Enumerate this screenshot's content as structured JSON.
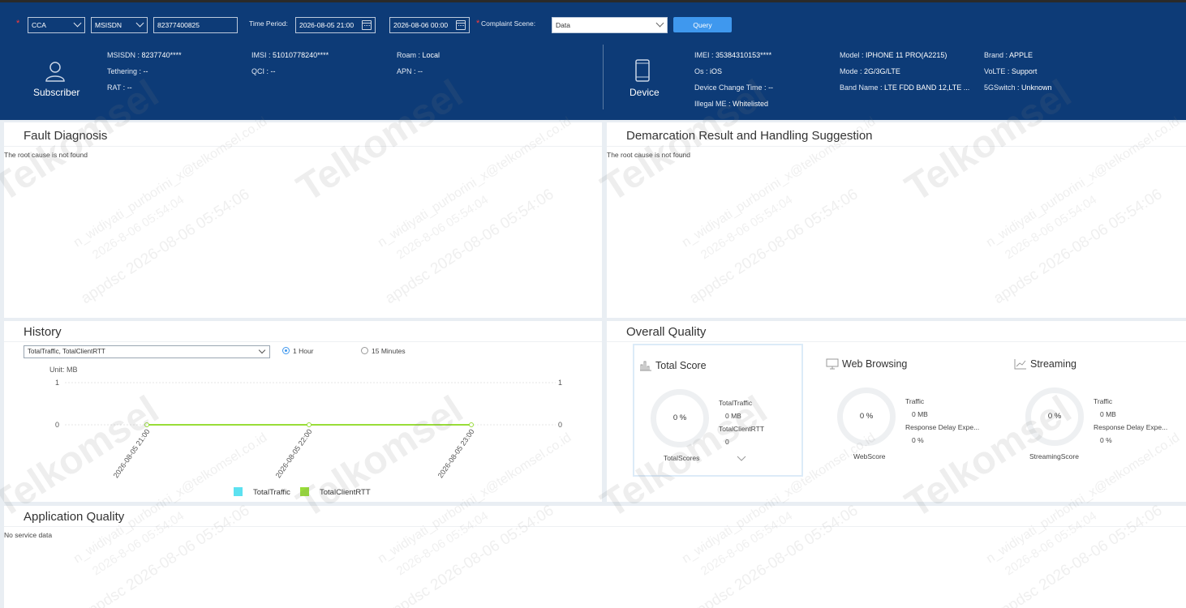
{
  "filters": {
    "mode_select": "CCA",
    "type_select": "MSISDN",
    "msisdn_value": "82377400825",
    "time_period_label": "Time Period:",
    "start_time": "2026-08-05 21:00",
    "end_time": "2026-08-06 00:00",
    "complaint_scene_label": "Complaint Scene:",
    "complaint_scene_value": "Data",
    "query_label": "Query"
  },
  "subscriber": {
    "label": "Subscriber",
    "fields": [
      {
        "k": "MSISDN",
        "v": "8237740****"
      },
      {
        "k": "Tethering",
        "v": "--"
      },
      {
        "k": "RAT",
        "v": "--"
      },
      {
        "k": "IMSI",
        "v": "51010778240****"
      },
      {
        "k": "QCI",
        "v": "--"
      },
      {
        "k": "Roam",
        "v": "Local"
      },
      {
        "k": "APN",
        "v": "--"
      }
    ]
  },
  "device": {
    "label": "Device",
    "fields": [
      {
        "k": "IMEI",
        "v": "35384310153****"
      },
      {
        "k": "Os",
        "v": "iOS"
      },
      {
        "k": "Device Change Time",
        "v": "--"
      },
      {
        "k": "Illegal ME",
        "v": "Whitelisted"
      },
      {
        "k": "Model",
        "v": "IPHONE 11 PRO(A2215)"
      },
      {
        "k": "Mode",
        "v": "2G/3G/LTE"
      },
      {
        "k": "Band Name",
        "v": "LTE FDD BAND 12,LTE ..."
      },
      {
        "k": "Brand",
        "v": "APPLE"
      },
      {
        "k": "VoLTE",
        "v": "Support"
      },
      {
        "k": "5GSwitch",
        "v": "Unknown"
      }
    ]
  },
  "fault_diagnosis": {
    "title": "Fault Diagnosis",
    "message": "The root cause is not found"
  },
  "demarcation": {
    "title": "Demarcation Result and Handling Suggestion",
    "message": "The root cause is not found"
  },
  "history": {
    "title": "History",
    "metric_select": "TotalTraffic, TotalClientRTT",
    "radio_1h": "1 Hour",
    "radio_15m": "15 Minutes",
    "selected_interval": "1 Hour"
  },
  "chart_data": {
    "type": "line",
    "unit_label": "Unit: MB",
    "x": [
      "2026-08-05 21:00",
      "2026-08-05 22:00",
      "2026-08-05 23:00"
    ],
    "series": [
      {
        "name": "TotalTraffic",
        "values": [
          0,
          0,
          0
        ],
        "color": "#5ce1f0"
      },
      {
        "name": "TotalClientRTT",
        "values": [
          0,
          0,
          0
        ],
        "color": "#98dd38"
      }
    ],
    "y_left_ticks": [
      "1",
      "0"
    ],
    "y_right_ticks": [
      "1",
      "0"
    ],
    "ylim": [
      0,
      1
    ],
    "grid": true,
    "legend_placement": "bottom"
  },
  "overall_quality": {
    "title": "Overall Quality",
    "cards": [
      {
        "title": "Total Score",
        "icon": "bar-chart-icon",
        "score": "0 %",
        "k1": "TotalTraffic",
        "v1": "0 MB",
        "k2": "TotalClientRTT",
        "v2": "0",
        "footer": "TotalScores"
      },
      {
        "title": "Web Browsing",
        "icon": "monitor-icon",
        "score": "0 %",
        "k1": "Traffic",
        "v1": "0 MB",
        "k2": "Response Delay Expe...",
        "v2": "0 %",
        "footer": "WebScore"
      },
      {
        "title": "Streaming",
        "icon": "line-chart-icon",
        "score": "0 %",
        "k1": "Traffic",
        "v1": "0 MB",
        "k2": "Response Delay Expe...",
        "v2": "0 %",
        "footer": "StreamingScore"
      }
    ]
  },
  "application_quality": {
    "title": "Application Quality",
    "message": "No service data"
  },
  "watermark": {
    "brand": "Telkomsel",
    "user": "n_widiyati_purborini_x@telkomsel.co.id",
    "stamp": "appdsc 2026-08-06 05:54:06",
    "stamp2": "2026-8-06 05:54:04"
  }
}
